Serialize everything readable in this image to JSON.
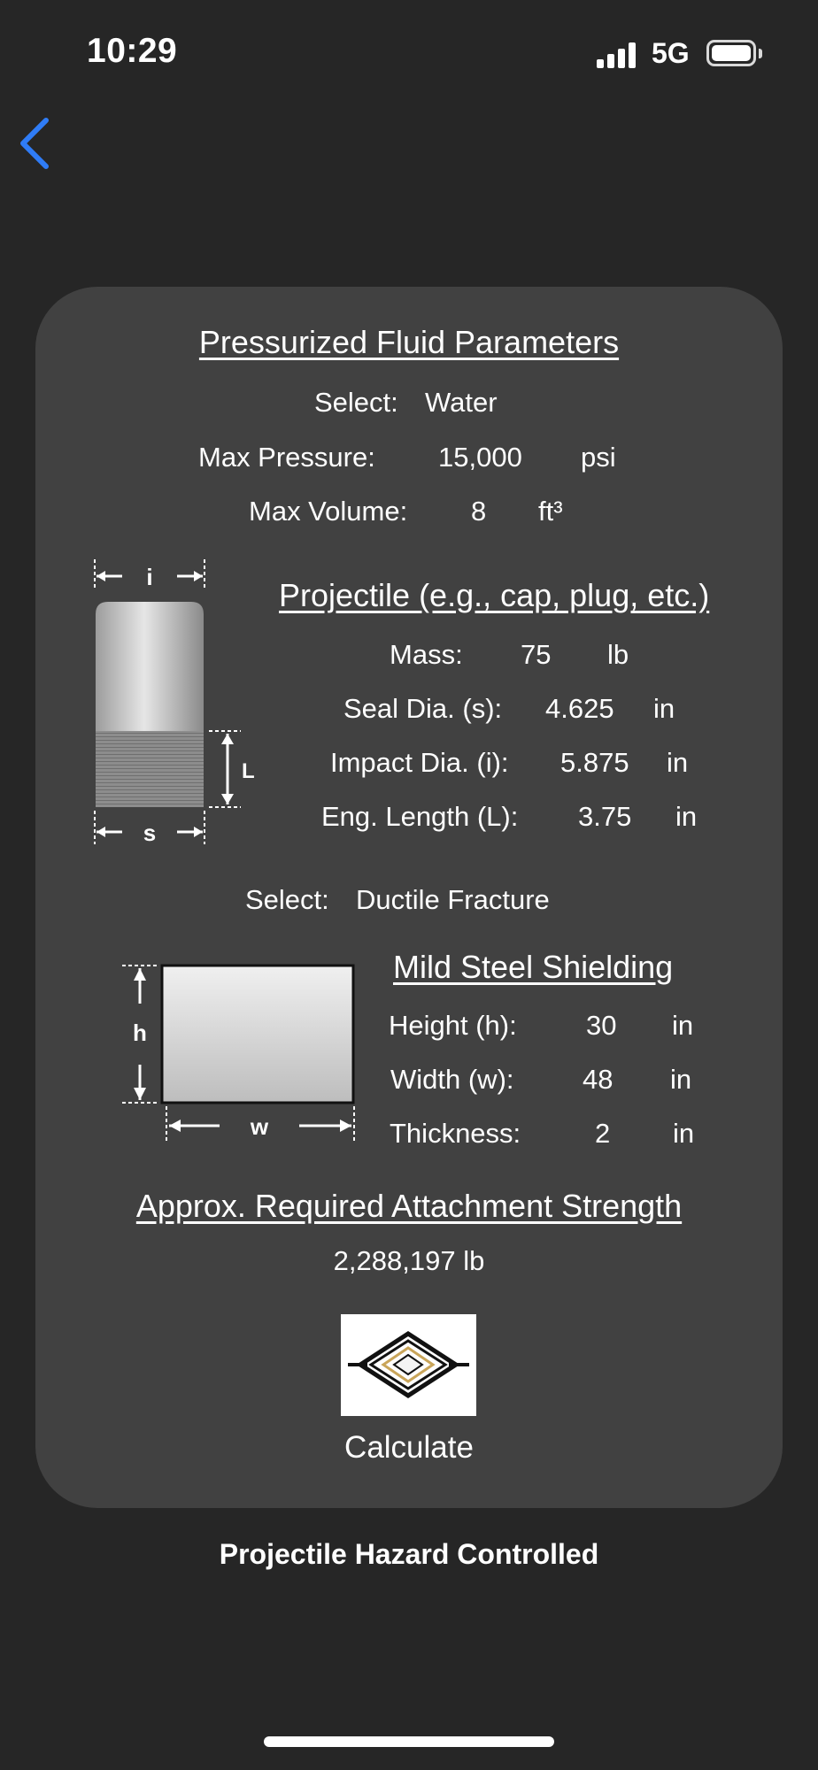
{
  "status_bar": {
    "time": "10:29",
    "network": "5G",
    "signal_bars": 4
  },
  "icons": {
    "back": "chevron-left-icon",
    "signal": "cellular-signal-icon",
    "battery": "battery-icon",
    "logo": "diamond-logo-icon"
  },
  "colors": {
    "background": "#262626",
    "card": "#414141",
    "accent": "#2f7cf6",
    "text": "#ffffff"
  },
  "fluid": {
    "heading": "Pressurized Fluid Parameters",
    "select_label": "Select:",
    "select_value": "Water",
    "max_pressure_label": "Max Pressure:",
    "max_pressure_value": "15,000",
    "max_pressure_unit": "psi",
    "max_volume_label": "Max Volume:",
    "max_volume_value": "8",
    "max_volume_unit": "ft³"
  },
  "projectile": {
    "heading": "Projectile (e.g., cap, plug, etc.)",
    "diagram_labels": {
      "impact": "i",
      "seal": "s",
      "length": "L"
    },
    "mass_label": "Mass:",
    "mass_value": "75",
    "mass_unit": "lb",
    "seal_label": "Seal Dia. (s):",
    "seal_value": "4.625",
    "seal_unit": "in",
    "impact_label": "Impact Dia. (i):",
    "impact_value": "5.875",
    "impact_unit": "in",
    "length_label": "Eng. Length (L):",
    "length_value": "3.75",
    "length_unit": "in"
  },
  "failure": {
    "select_label": "Select:",
    "select_value": "Ductile Fracture"
  },
  "shielding": {
    "heading": "Mild Steel Shielding",
    "diagram_labels": {
      "height": "h",
      "width": "w"
    },
    "height_label": "Height (h):",
    "height_value": "30",
    "height_unit": "in",
    "width_label": "Width (w):",
    "width_value": "48",
    "width_unit": "in",
    "thickness_label": "Thickness:",
    "thickness_value": "2",
    "thickness_unit": "in"
  },
  "result": {
    "heading": "Approx. Required Attachment Strength",
    "value": "2,288,197 lb"
  },
  "calculate_label": "Calculate",
  "footer": "Projectile Hazard Controlled"
}
